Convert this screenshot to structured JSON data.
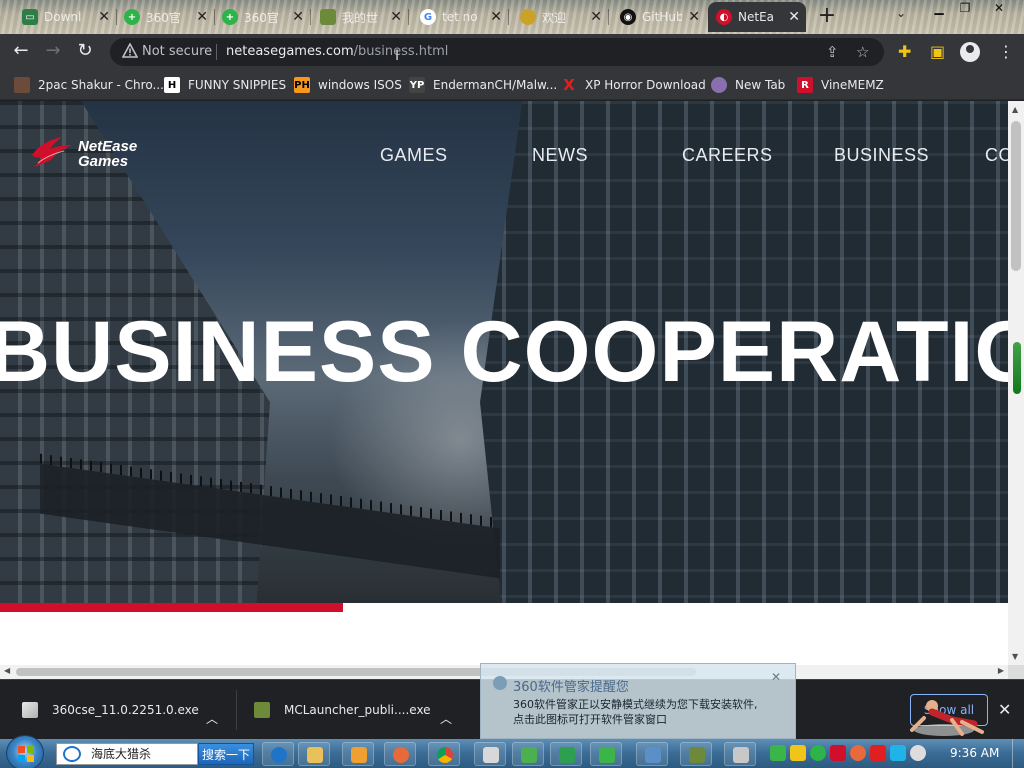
{
  "tabs": [
    {
      "title": "Downl",
      "icon": "download-favicon",
      "color": "#2d7d46"
    },
    {
      "title": "360官",
      "icon": "360-favicon",
      "color": "#2db34a"
    },
    {
      "title": "360官",
      "icon": "360-favicon",
      "color": "#2db34a"
    },
    {
      "title": "我的世",
      "icon": "minecraft-favicon",
      "color": "#6c8a3a"
    },
    {
      "title": "tet no",
      "icon": "google-favicon",
      "color": "#4285f4"
    },
    {
      "title": "欢迎",
      "icon": "coin-favicon",
      "color": "#c9a227"
    },
    {
      "title": "GitHub",
      "icon": "github-favicon",
      "color": "#111111"
    },
    {
      "title": "NetEa",
      "icon": "netease-favicon",
      "color": "#d0102a",
      "active": true
    }
  ],
  "toolbar": {
    "security_label": "Not secure",
    "url_host": "neteasegames.com",
    "url_path": "/business.html"
  },
  "bookmarks": [
    {
      "label": "2pac Shakur - Chro...",
      "icon": "tupac-icon",
      "color": "#6b4b3a"
    },
    {
      "label": "FUNNY SNIPPIES",
      "icon": "h-icon",
      "color": "#ffffff"
    },
    {
      "label": "windows ISOS",
      "icon": "ph-icon",
      "color": "#f7971d"
    },
    {
      "label": "EndermanCH/Malw...",
      "icon": "yp-icon",
      "color": "#444444"
    },
    {
      "label": "XP Horror Download",
      "icon": "x-icon",
      "color": "#e02020"
    },
    {
      "label": "New Tab",
      "icon": "newtab-icon",
      "color": "#8a6fb0"
    },
    {
      "label": "VineMEMZ",
      "icon": "r-icon",
      "color": "#d0102a"
    }
  ],
  "site": {
    "logo_line1": "NetEase",
    "logo_line2": "Games",
    "nav": [
      "GAMES",
      "NEWS",
      "CAREERS",
      "BUSINESS",
      "CO"
    ],
    "hero_title": "BUSINESS COOPERATION",
    "accent": "#d0102a"
  },
  "downloads": {
    "items": [
      {
        "filename": "360cse_11.0.2251.0.exe"
      },
      {
        "filename": "MCLauncher_publi....exe"
      }
    ],
    "show_all": "Show all"
  },
  "popup360": {
    "title": "360软件管家提醒您",
    "line1": "360软件管家正以安静模式继续为您下载安装软件,",
    "line2": "点击此图标可打开软件管家窗口"
  },
  "taskbar": {
    "search_text": "海底大猎杀",
    "search_button": "搜索一下",
    "clock": "9:36 AM"
  }
}
